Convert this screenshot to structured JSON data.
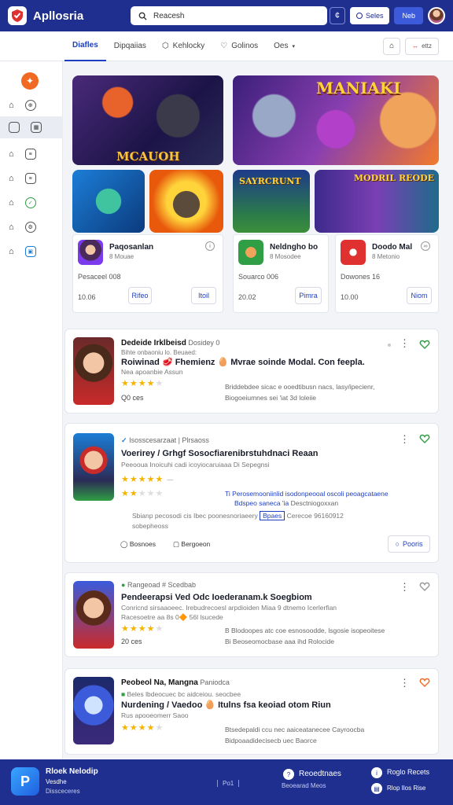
{
  "app": {
    "title": "Apllosria"
  },
  "search": {
    "value": "Reacesh"
  },
  "topbar": {
    "icon_label": "¢",
    "pill_white_label": "Seles",
    "pill_blue_label": "Neb"
  },
  "tabs": [
    {
      "label": "Diafles",
      "active": true
    },
    {
      "label": "Dipqaiias"
    },
    {
      "label": "Kehlocky"
    },
    {
      "label": "Golinos"
    },
    {
      "label": "Oes"
    }
  ],
  "tab_actions": {
    "filter_label": "ettz"
  },
  "sidebar": {
    "items": [
      "Home",
      "Library",
      "Store",
      "Friends",
      "Chat",
      "Community",
      "Stats"
    ]
  },
  "hero": {
    "left_title": "MCAUOH",
    "right_title": "MANIAKI",
    "tile3_title": "SAYRCRUNT",
    "tile4_title": "MODRIL REODE"
  },
  "game_cards": [
    {
      "name": "Paqosanlan",
      "sub": "8 Mouae",
      "downloads": "Pesaceel 008",
      "price": "10.06",
      "button": "Rifeo"
    },
    {
      "name": "Neldngho bo",
      "sub": "8 Mosodee",
      "downloads": "Souarco 006",
      "price": "20.02",
      "button": "Pimra"
    },
    {
      "name": "Doodo Mal",
      "sub": "8 Metonio",
      "downloads": "Dowones 16",
      "price": "10.00",
      "button": "Niom"
    }
  ],
  "list": [
    {
      "meta_bold": "Dedeide Irklbeisd",
      "meta": "Dosidey 0",
      "title": "Roiwinad 🥩 Fhemienz 🥚 Mvrae soinde Modal. Con feepla.",
      "desc1": "Bihte onbaoniu lo. Beuaed:",
      "desc2": "Nea apoanbie Assun",
      "rating": "4.5",
      "count": "Q0 ces",
      "right1": "Briddebdee sicac e ooedtibusn nacs, lasy/ipecienr,",
      "right2": "Biogoeiumnes sei 'iat 3d loleiie"
    },
    {
      "meta_bold": "",
      "meta": "Isosscesarzaat | Plrsaoss",
      "title": "Voerirey / Grhgf Sosocfiarenibrstuhdnaci Reaan",
      "desc1": "Peeooua Inoicuhi cadi icoyiocaruiaaa Di Sepegnsi",
      "rating": "5",
      "rating2": "3",
      "count": "",
      "right1": "Ti Perosemooniinlid isodonpeooal oscoli peoagcataene",
      "right2": "Bdspeo saneca 'ia",
      "right2b": "Desctniogoxxan",
      "tag": "Bpaes",
      "detail1": "Sbianp pecosodi cis Ibec poonesnoriaeery",
      "detail2": "Cerecoe 96160912",
      "detail3": "sobepheoss",
      "action1": "Bosnoes",
      "action2": "Bergoeon",
      "cta": "Pooris"
    },
    {
      "meta_bold": "",
      "meta": "Rangeoad # Scedbab",
      "title": "Pendeerapsi Ved Odc Ioederanam.k Soegbiom",
      "desc1": "Conricnd sirsaaoeec. Irebudrecoesl arpdioiden Miaa 9 dtnemo Icerlerfian",
      "desc2": "Racesoetre aa 8s 0🔶 56l lsucede",
      "rating": "4.5",
      "count": "20 ces",
      "right1": "B Blodoopes atc coe esnosoodde, lsgosie isopeoitese",
      "right2": "Bi Beoseomocbase aaa ihd Rolocide"
    },
    {
      "meta_bold": "Peobeol Na, Mangna",
      "meta": "Paniodca",
      "title": "Nurdening  / Vaedoo 🥚 Itulns fsa keoiad otom Riun",
      "desc1": "Beles lbdeocuec bc aidceiou. seocbee",
      "desc2": "Rus apooeomerr Saoo",
      "rating": "4.5",
      "count": "",
      "right1": "Btsedepaldi ccu nec aaiceatanecee Cayroocba",
      "right2": "Bidpoaadidecisecb uec Baorce"
    }
  ],
  "footer": {
    "brand": "Rloek Nelodip",
    "brand_sub1": "Vesdhe",
    "brand_sub2": "Dissceceres",
    "center_label": "Po1",
    "link1_title": "Reoedtnaes",
    "link1_sub": "Beoearad Meos",
    "link2_title": "Roglo Recets",
    "link2_sub": "Rlop Ilos Rise"
  },
  "colors": {
    "brand": "#1e2f8f",
    "accent": "#1e3fbf",
    "star": "#f4b400",
    "orange": "#f06a24"
  }
}
